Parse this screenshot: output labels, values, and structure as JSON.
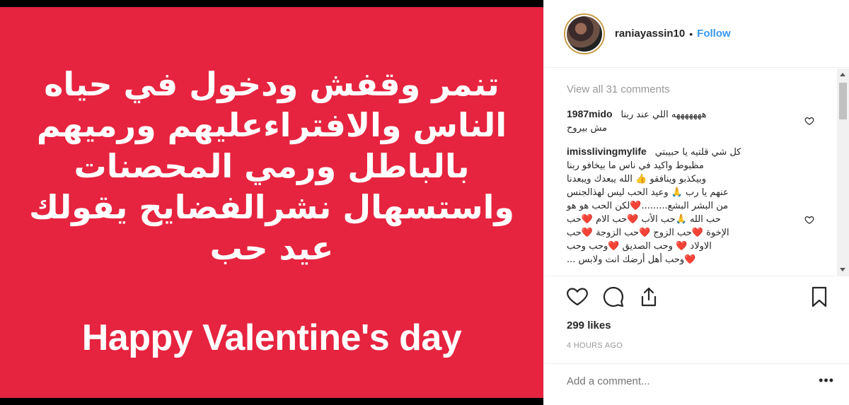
{
  "post_image": {
    "arabic_lines": [
      "تنمر وقفش ودخول في حياه",
      "الناس والافتراءعليهم ورميهم",
      "بالباطل ورمي المحصنات",
      "واستسهال نشرالفضايح يقولك",
      "عيد حب"
    ],
    "english_line": "Happy Valentine's day",
    "background_color": "#e6243f"
  },
  "header": {
    "username": "raniayassin10",
    "separator": "•",
    "follow_label": "Follow"
  },
  "comments": {
    "view_all_label": "View all 31 comments",
    "items": [
      {
        "user": "1987mido",
        "lines": [
          "هههههههه اللي عند ربنا",
          "مش بيروح"
        ]
      },
      {
        "user": "imisslivingmylife",
        "lines": [
          "كل شي قلتيه يا حبيبتي",
          "مظبوط واكيد في ناس ما بيخافو ربنا",
          "وبيكذبو وينافقو 👍 الله يبعدك ويبعدنا",
          "عنهم يا رب 🙏 وعيد الحب ليس لهذالجنس",
          "من البشر البشع.........❤️لكن الحب هو هو",
          "حب الله 🙏حب الأب ❤️حب الام ❤️حب",
          "الإخوة ❤️حب الزوج ❤️حب الزوجة ❤️حب",
          "الاولاد ❤️ وحب الصديق ❤️وحب وحب",
          "❤️وحب أهل أرضك انت ولابس ..."
        ]
      }
    ]
  },
  "stats": {
    "likes": "299 likes",
    "time": "4 HOURS AGO"
  },
  "add_comment": {
    "placeholder": "Add a comment...",
    "more_label": "•••"
  },
  "icons": [
    "heart-icon",
    "comment-icon",
    "share-icon",
    "bookmark-icon"
  ]
}
